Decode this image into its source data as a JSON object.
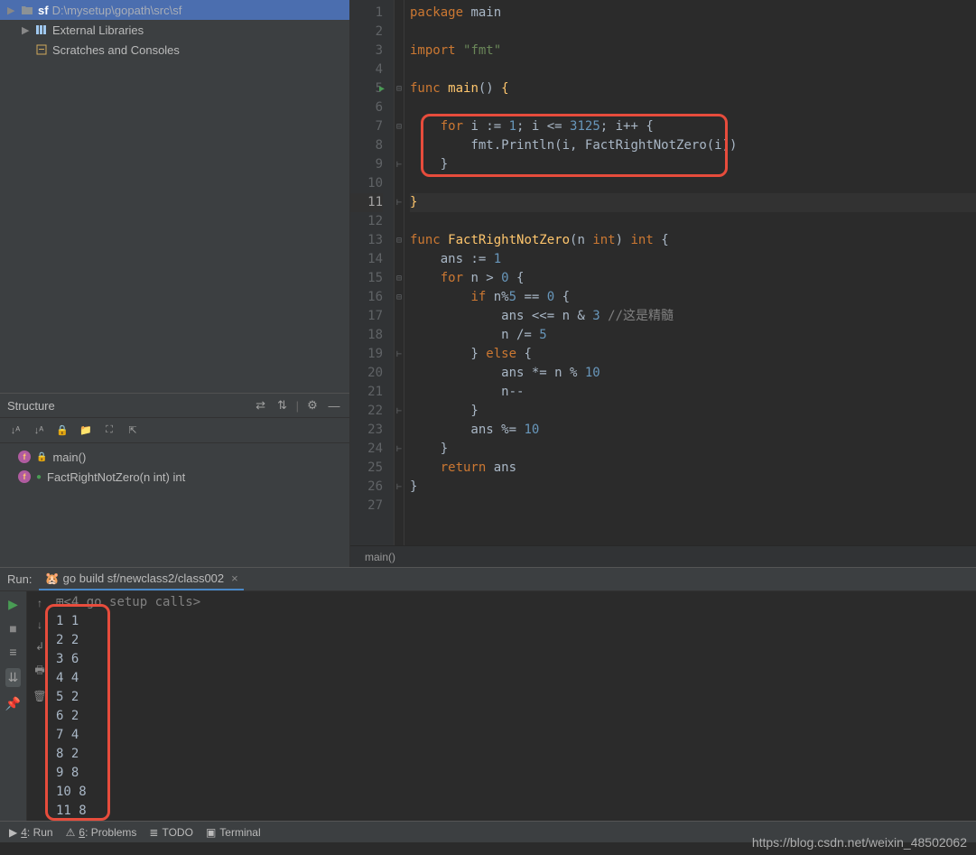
{
  "project": {
    "root_name": "sf",
    "root_path": "D:\\mysetup\\gopath\\src\\sf",
    "external_libraries": "External Libraries",
    "scratches": "Scratches and Consoles"
  },
  "structure": {
    "title": "Structure",
    "items": [
      {
        "name": "main()"
      },
      {
        "name": "FactRightNotZero(n int) int"
      }
    ]
  },
  "code": {
    "lines": [
      "package main",
      "",
      "import \"fmt\"",
      "",
      "func main() {",
      "",
      "    for i := 1; i <= 3125; i++ {",
      "        fmt.Println(i, FactRightNotZero(i))",
      "        }",
      "",
      "}",
      "",
      "func FactRightNotZero(n int) int {",
      "    ans := 1",
      "    for n > 0 {",
      "        if n%5 == 0 {",
      "            ans <<= n & 3 //这是精髓",
      "            n /= 5",
      "        } else {",
      "            ans *= n % 10",
      "            n--",
      "        }",
      "        ans %= 10",
      "    }",
      "    return ans",
      "}",
      ""
    ],
    "breadcrumb": "main()"
  },
  "run": {
    "title": "Run:",
    "tab_label": "go build sf/newclass2/class002",
    "setup_line": "<4 go setup calls>",
    "output_lines": [
      "1 1",
      "2 2",
      "3 6",
      "4 4",
      "5 2",
      "6 2",
      "7 4",
      "8 2",
      "9 8",
      "10 8",
      "11 8"
    ]
  },
  "bottom": {
    "run": "4: Run",
    "problems": "6: Problems",
    "todo": "TODO",
    "terminal": "Terminal"
  },
  "watermark": "https://blog.csdn.net/weixin_48502062"
}
